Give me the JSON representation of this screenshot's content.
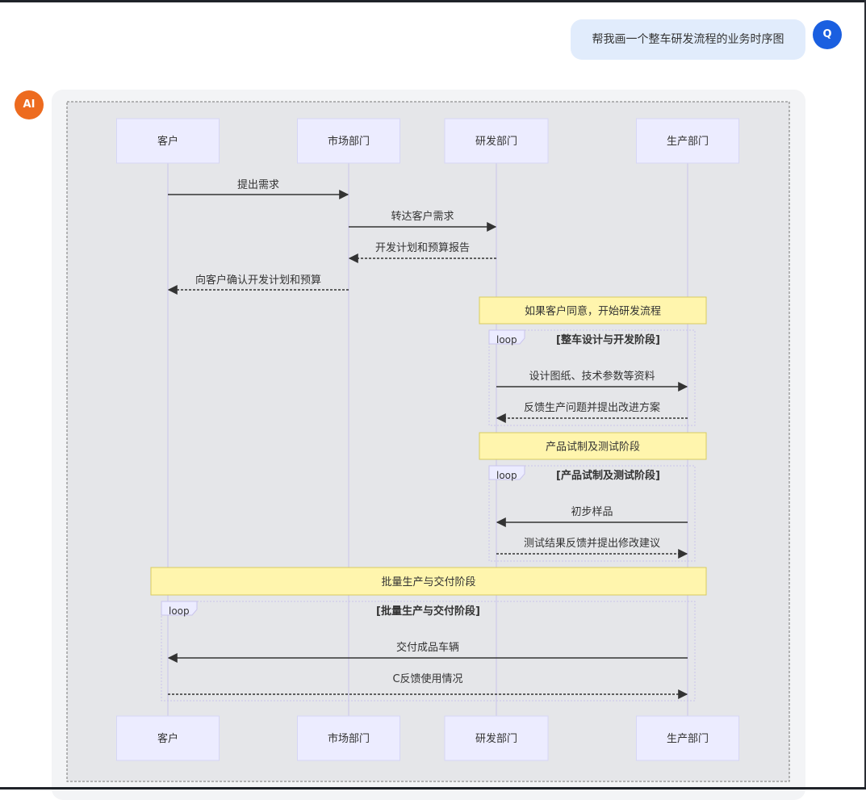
{
  "user_message": {
    "avatar": "Q",
    "text": "帮我画一个整车研发流程的业务时序图"
  },
  "ai_message": {
    "avatar": "AI"
  },
  "diagram": {
    "participants": [
      "客户",
      "市场部门",
      "研发部门",
      "生产部门"
    ],
    "messages": [
      {
        "from": 0,
        "to": 1,
        "label": "提出需求",
        "style": "solid"
      },
      {
        "from": 1,
        "to": 2,
        "label": "转达客户需求",
        "style": "solid"
      },
      {
        "from": 2,
        "to": 1,
        "label": "开发计划和预算报告",
        "style": "dashed"
      },
      {
        "from": 1,
        "to": 0,
        "label": "向客户确认开发计划和预算",
        "style": "dashed"
      },
      {
        "from": 2,
        "to": 3,
        "label": "设计图纸、技术参数等资料",
        "style": "solid"
      },
      {
        "from": 3,
        "to": 2,
        "label": "反馈生产问题并提出改进方案",
        "style": "dashed"
      },
      {
        "from": 3,
        "to": 2,
        "label": "初步样品",
        "style": "solid"
      },
      {
        "from": 2,
        "to": 3,
        "label": "测试结果反馈并提出修改建议",
        "style": "dashed"
      },
      {
        "from": 3,
        "to": 0,
        "label": "交付成品车辆",
        "style": "solid"
      },
      {
        "from": 0,
        "to": 3,
        "label": "C反馈使用情况",
        "style": "dashed"
      }
    ],
    "notes": [
      "如果客户同意，开始研发流程",
      "产品试制及测试阶段",
      "批量生产与交付阶段"
    ],
    "loops": [
      {
        "keyword": "loop",
        "title": "[整车设计与开发阶段]"
      },
      {
        "keyword": "loop",
        "title": "[产品试制及测试阶段]"
      },
      {
        "keyword": "loop",
        "title": "[批量生产与交付阶段]"
      }
    ],
    "colors": {
      "participant_fill": "#ececff",
      "participant_stroke": "#d6d6f5",
      "note_fill": "#fff5ad",
      "note_stroke": "#d8cc5f",
      "line": "#333333",
      "lifeline": "#c9c4ec"
    }
  }
}
